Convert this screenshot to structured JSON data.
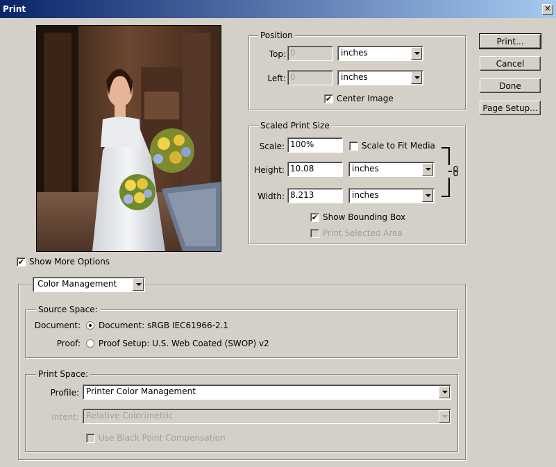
{
  "window": {
    "title": "Print",
    "close_glyph": "✕"
  },
  "buttons": {
    "print": "Print...",
    "cancel": "Cancel",
    "done": "Done",
    "page_setup": "Page Setup..."
  },
  "position": {
    "legend": "Position",
    "top_label": "Top:",
    "top_value": "0",
    "top_unit": "inches",
    "left_label": "Left:",
    "left_value": "0",
    "left_unit": "inches",
    "center_image": "Center Image",
    "center_image_checked": true
  },
  "scaled": {
    "legend": "Scaled Print Size",
    "scale_label": "Scale:",
    "scale_value": "100%",
    "scale_to_fit": "Scale to Fit Media",
    "height_label": "Height:",
    "height_value": "10.08",
    "height_unit": "inches",
    "width_label": "Width:",
    "width_value": "8.213",
    "width_unit": "inches",
    "show_bounding_box": "Show Bounding Box",
    "show_bounding_box_checked": true,
    "print_selected_area": "Print Selected Area"
  },
  "show_more_options": {
    "label": "Show More Options",
    "checked": true
  },
  "color_mgmt": {
    "mode": "Color Management",
    "source_legend": "Source Space:",
    "document_label": "Document:",
    "document_option": "Document:  sRGB IEC61966-2.1",
    "proof_label": "Proof:",
    "proof_option": "Proof Setup:  U.S. Web Coated (SWOP) v2",
    "print_legend": "Print Space:",
    "profile_label": "Profile:",
    "profile_value": "Printer Color Management",
    "intent_label": "Intent:",
    "intent_value": "Relative Colorimetric",
    "black_point": "Use Black Point Compensation"
  },
  "icons": {
    "close": "close-icon",
    "link": "chain-link-icon",
    "check": "checkmark-icon"
  }
}
